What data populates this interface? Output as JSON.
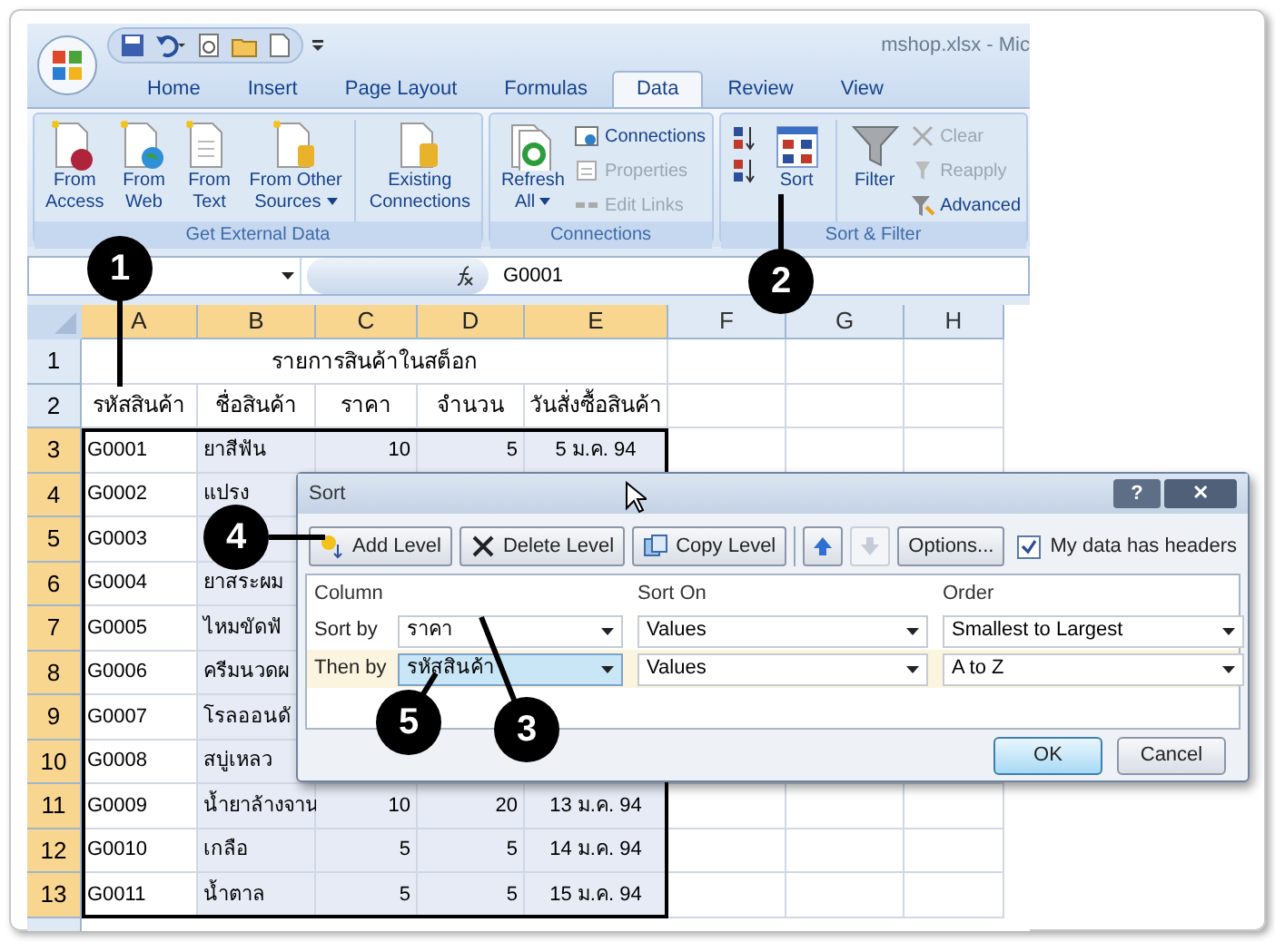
{
  "window": {
    "title": "mshop.xlsx - Mic"
  },
  "ribbon_tabs": [
    {
      "label": "Home",
      "selected": false
    },
    {
      "label": "Insert",
      "selected": false
    },
    {
      "label": "Page Layout",
      "selected": false
    },
    {
      "label": "Formulas",
      "selected": false
    },
    {
      "label": "Data",
      "selected": true
    },
    {
      "label": "Review",
      "selected": false
    },
    {
      "label": "View",
      "selected": false
    }
  ],
  "ribbon_groups": [
    {
      "label": "Get External Data",
      "buttons": [
        {
          "kind": "access",
          "lines": [
            "From",
            "Access"
          ]
        },
        {
          "kind": "web",
          "lines": [
            "From",
            "Web"
          ]
        },
        {
          "kind": "text",
          "lines": [
            "From",
            "Text"
          ]
        },
        {
          "kind": "other",
          "lines": [
            "From Other",
            "Sources"
          ],
          "dropdown": true
        },
        {
          "kind": "existing",
          "lines": [
            "Existing",
            "Connections"
          ]
        }
      ]
    },
    {
      "label": "Connections",
      "buttons": [
        {
          "kind": "refresh",
          "lines": [
            "Refresh",
            "All"
          ],
          "dropdown": true
        }
      ],
      "small": [
        {
          "kind": "connections",
          "label": "Connections",
          "disabled": false
        },
        {
          "kind": "properties",
          "label": "Properties",
          "disabled": true
        },
        {
          "kind": "links",
          "label": "Edit Links",
          "disabled": true
        }
      ]
    },
    {
      "label": "Sort & Filter",
      "buttons": [
        {
          "kind": "sortaz"
        },
        {
          "kind": "sort",
          "lines": [
            "Sort"
          ]
        },
        {
          "kind": "filter",
          "lines": [
            "Filter"
          ]
        }
      ],
      "small": [
        {
          "kind": "clear",
          "label": "Clear",
          "disabled": true
        },
        {
          "kind": "reapply",
          "label": "Reapply",
          "disabled": true
        },
        {
          "kind": "advanced",
          "label": "Advanced",
          "disabled": false
        }
      ]
    }
  ],
  "formula_bar": {
    "formula": "G0001"
  },
  "sheet": {
    "columns": [
      {
        "label": "A",
        "selected": true
      },
      {
        "label": "B",
        "selected": true
      },
      {
        "label": "C",
        "selected": true
      },
      {
        "label": "D",
        "selected": true
      },
      {
        "label": "E",
        "selected": true
      },
      {
        "label": "F",
        "selected": false
      },
      {
        "label": "G",
        "selected": false
      },
      {
        "label": "H",
        "selected": false
      }
    ],
    "title": "รายการสินค้าในสต็อก",
    "rows": [
      {
        "number": "1",
        "selected": false,
        "cells": []
      },
      {
        "number": "2",
        "selected": false,
        "cells": [
          "รหัสสินค้า",
          "ชื่อสินค้า",
          "ราคา",
          "จำนวน",
          "วันสั่งซื้อสินค้า"
        ]
      },
      {
        "number": "3",
        "selected": true,
        "cells": [
          "G0001",
          "ยาสีฟัน",
          "10",
          "5",
          "5 ม.ค. 94"
        ]
      },
      {
        "number": "4",
        "selected": true,
        "cells": [
          "G0002",
          "แปรง"
        ]
      },
      {
        "number": "5",
        "selected": true,
        "cells": [
          "G0003"
        ]
      },
      {
        "number": "6",
        "selected": true,
        "cells": [
          "G0004",
          "ยาสระผม"
        ]
      },
      {
        "number": "7",
        "selected": true,
        "cells": [
          "G0005",
          "ไหมขัดฟั"
        ]
      },
      {
        "number": "8",
        "selected": true,
        "cells": [
          "G0006",
          "ครีมนวดผ"
        ]
      },
      {
        "number": "9",
        "selected": true,
        "cells": [
          "G0007",
          "โรลออนดั"
        ]
      },
      {
        "number": "10",
        "selected": true,
        "cells": [
          "G0008",
          "สบู่เหลว"
        ]
      },
      {
        "number": "11",
        "selected": true,
        "cells": [
          "G0009",
          "น้ำยาล้างจาน",
          "10",
          "20",
          "13 ม.ค. 94"
        ]
      },
      {
        "number": "12",
        "selected": true,
        "cells": [
          "G0010",
          "เกลือ",
          "5",
          "5",
          "14 ม.ค. 94"
        ]
      },
      {
        "number": "13",
        "selected": true,
        "cells": [
          "G0011",
          "น้ำตาล",
          "5",
          "5",
          "15 ม.ค. 94"
        ]
      }
    ]
  },
  "sort_dialog": {
    "title": "Sort",
    "title_buttons": [
      "?",
      "✕"
    ],
    "toolbar": [
      {
        "kind": "add",
        "label": "Add Level",
        "disabled": false
      },
      {
        "kind": "delete",
        "label": "Delete Level",
        "disabled": false
      },
      {
        "kind": "copy",
        "label": "Copy Level",
        "disabled": false
      },
      {
        "kind": "up",
        "disabled": false
      },
      {
        "kind": "down",
        "disabled": true
      },
      {
        "kind": "options",
        "label": "Options...",
        "disabled": false
      }
    ],
    "headers_checkbox": {
      "label": "My data has headers",
      "checked": true
    },
    "columns": [
      "Column",
      "Sort On",
      "Order"
    ],
    "levels": [
      {
        "label": "Sort by",
        "column": "ราคา",
        "sort_on": "Values",
        "order": "Smallest to Largest",
        "selected": false
      },
      {
        "label": "Then by",
        "column": "รหัสสินค้า",
        "sort_on": "Values",
        "order": "A to Z",
        "selected": true
      }
    ],
    "buttons": [
      "OK",
      "Cancel"
    ]
  },
  "callouts": [
    "1",
    "2",
    "3",
    "4",
    "5"
  ]
}
